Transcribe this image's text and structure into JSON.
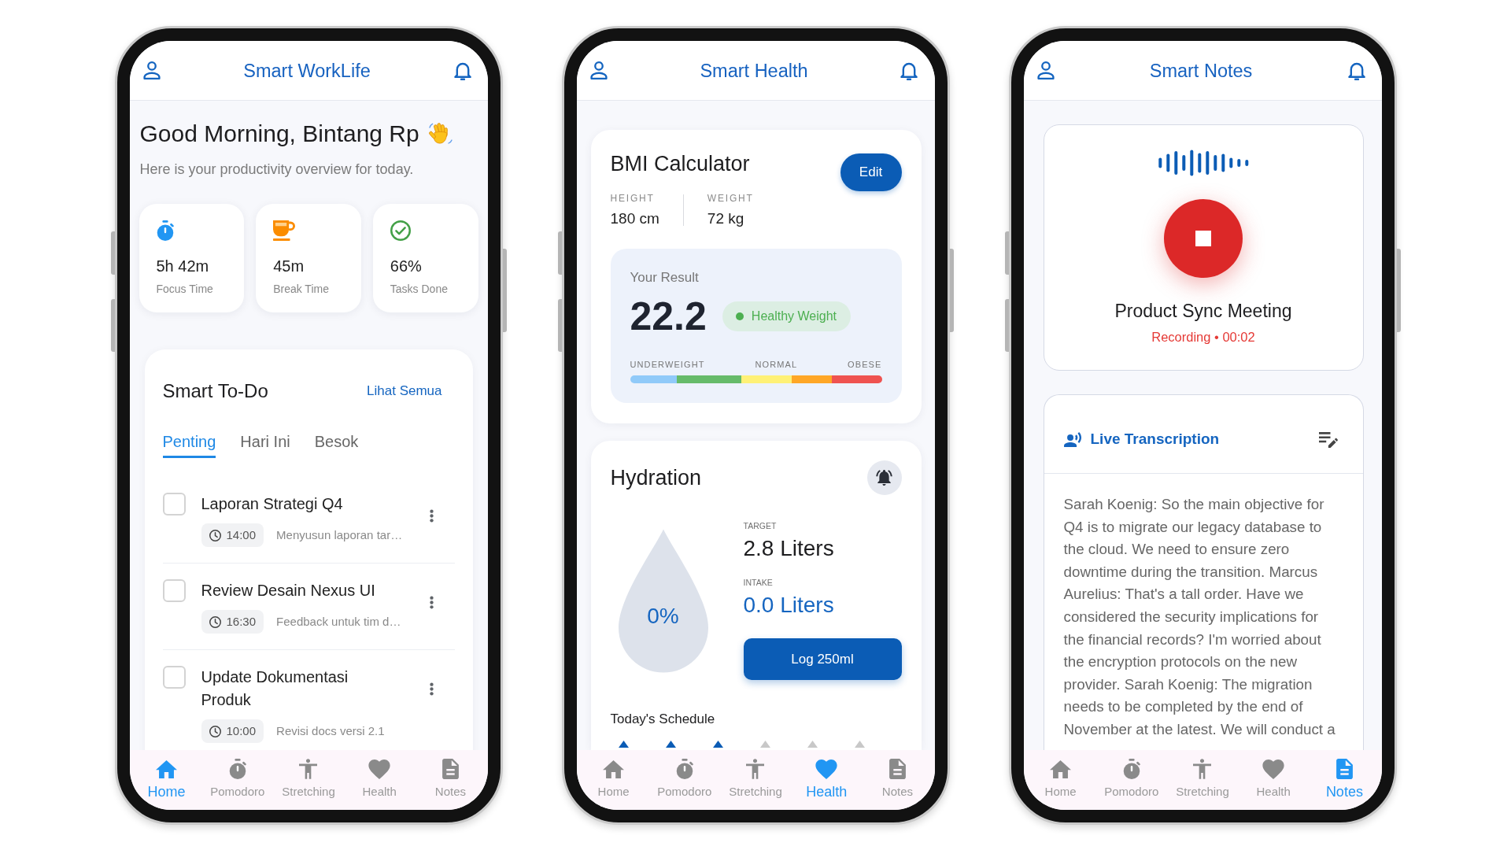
{
  "phones": [
    {
      "kind": "worklife",
      "title": "Smart WorkLife",
      "greeting": "Good Morning, Bintang Rp",
      "subtitle": "Here is your productivity overview for today.",
      "stats": [
        {
          "kind": "timer",
          "value": "5h 42m",
          "label": "Focus Time"
        },
        {
          "kind": "cup",
          "value": "45m",
          "label": "Break Time"
        },
        {
          "kind": "check",
          "value": "66%",
          "label": "Tasks Done"
        }
      ],
      "todo": {
        "title": "Smart To-Do",
        "link": "Lihat Semua",
        "tabs": [
          {
            "label": "Penting",
            "selected": true
          },
          {
            "label": "Hari Ini",
            "selected": false
          },
          {
            "label": "Besok",
            "selected": false
          }
        ],
        "tasks": [
          {
            "title": "Laporan Strategi Q4",
            "checked": false,
            "time": "14:00",
            "note": "Menyusun laporan tar…"
          },
          {
            "title": "Review Desain Nexus UI",
            "checked": false,
            "time": "16:30",
            "note": "Feedback untuk tim d…"
          },
          {
            "title": "Update Dokumentasi Produk",
            "checked": false,
            "time": "10:00",
            "note": "Revisi docs versi 2.1"
          }
        ]
      },
      "nav": [
        {
          "kind": "home",
          "label": "Home",
          "selected": true
        },
        {
          "kind": "timer",
          "label": "Pomodoro",
          "selected": false
        },
        {
          "kind": "stretch",
          "label": "Stretching",
          "selected": false
        },
        {
          "kind": "heart",
          "label": "Health",
          "selected": false
        },
        {
          "kind": "document",
          "label": "Notes",
          "selected": false
        }
      ]
    },
    {
      "kind": "health",
      "title": "Smart Health",
      "bmi": {
        "title": "BMI Calculator",
        "edit_button": "Edit",
        "measures": [
          {
            "label": "HEIGHT",
            "value": "180 cm"
          },
          {
            "label": "WEIGHT",
            "value": "72 kg"
          }
        ],
        "result_label": "Your Result",
        "result": "22.2",
        "status": "Healthy Weight",
        "scale_labels": [
          "UNDERWEIGHT",
          "NORMAL",
          "OBESE"
        ]
      },
      "hydration": {
        "title": "Hydration",
        "percent": "0%",
        "stats": [
          {
            "kind": "target",
            "label": "TARGET",
            "value": "2.8 Liters"
          },
          {
            "kind": "intake",
            "label": "INTAKE",
            "value": "0.0 Liters"
          }
        ],
        "button": "Log 250ml",
        "schedule_title": "Today's Schedule",
        "schedule": [
          {
            "done": true
          },
          {
            "done": true
          },
          {
            "done": true
          },
          {
            "done": false
          },
          {
            "done": false
          },
          {
            "done": false
          }
        ]
      },
      "nav": [
        {
          "kind": "home",
          "label": "Home",
          "selected": false
        },
        {
          "kind": "timer",
          "label": "Pomodoro",
          "selected": false
        },
        {
          "kind": "stretch",
          "label": "Stretching",
          "selected": false
        },
        {
          "kind": "heart",
          "label": "Health",
          "selected": true
        },
        {
          "kind": "document",
          "label": "Notes",
          "selected": false
        }
      ]
    },
    {
      "kind": "notes",
      "title": "Smart Notes",
      "recording": {
        "title": "Product Sync Meeting",
        "status": "Recording • 00:02"
      },
      "transcription": {
        "title": "Live Transcription",
        "text": "Sarah Koenig: So the main objective for Q4 is to migrate our legacy database to the cloud. We need to ensure zero downtime during the transition. Marcus Aurelius: That's a tall order. Have we considered the security implications for the financial records? I'm worried about the encryption protocols on the new provider. Sarah Koenig: The migration needs to be completed by the end of November at the latest. We will conduct a"
      },
      "nav": [
        {
          "kind": "home",
          "label": "Home",
          "selected": false
        },
        {
          "kind": "timer",
          "label": "Pomodoro",
          "selected": false
        },
        {
          "kind": "stretch",
          "label": "Stretching",
          "selected": false
        },
        {
          "kind": "heart",
          "label": "Health",
          "selected": false
        },
        {
          "kind": "document",
          "label": "Notes",
          "selected": true
        }
      ]
    }
  ]
}
